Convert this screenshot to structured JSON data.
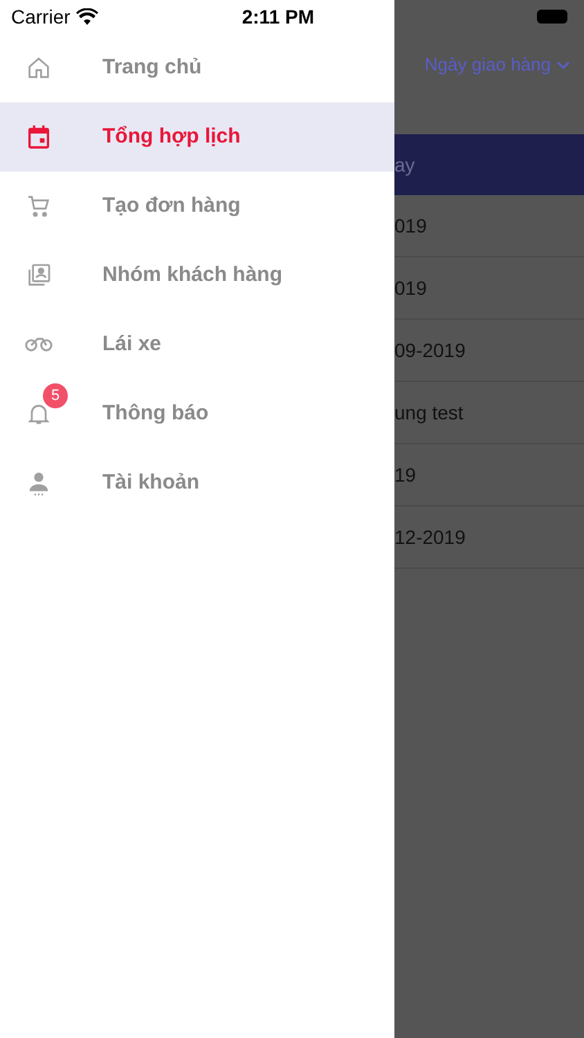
{
  "status_bar": {
    "carrier": "Carrier",
    "time": "2:11 PM"
  },
  "drawer": {
    "items": [
      {
        "kind": "home",
        "label": "Trang chủ",
        "selected": false
      },
      {
        "kind": "calendar",
        "label": "Tổng hợp lịch",
        "selected": true
      },
      {
        "kind": "cart",
        "label": "Tạo đơn hàng",
        "selected": false
      },
      {
        "kind": "contacts",
        "label": "Nhóm khách hàng",
        "selected": false
      },
      {
        "kind": "bike",
        "label": "Lái xe",
        "selected": false
      },
      {
        "kind": "bell",
        "label": "Thông báo",
        "selected": false,
        "badge": "5"
      },
      {
        "kind": "person",
        "label": "Tài khoản",
        "selected": false
      }
    ]
  },
  "background": {
    "sort_label": "Ngày giao hàng",
    "table": {
      "column_1": "ay",
      "rows": [
        "019",
        "019",
        "09-2019",
        "ung test",
        "19",
        "12-2019"
      ]
    }
  }
}
